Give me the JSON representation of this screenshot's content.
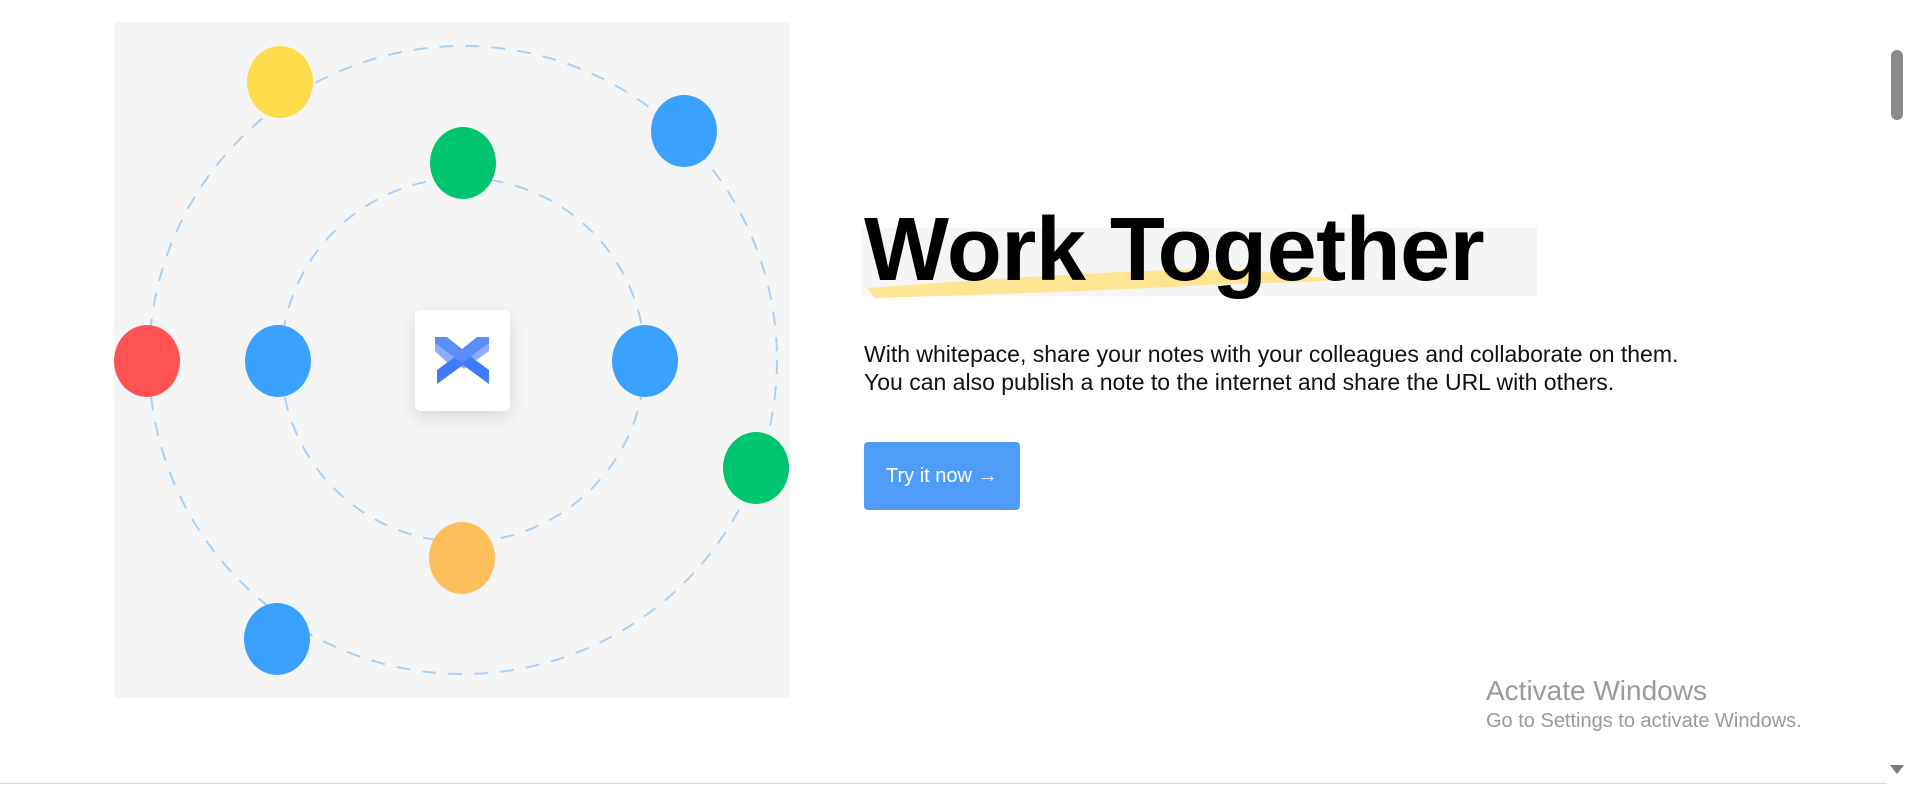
{
  "hero": {
    "title": "Work Together",
    "description_line1": "With whitepace, share your notes with your colleagues and collaborate on them.",
    "description_line2": "You can also publish a note to the internet and share the URL with others.",
    "cta_label": "Try it now →"
  },
  "illustration": {
    "center_icon": "whitepace-logo-icon",
    "dot_colors": {
      "yellow": "#FFDC4B",
      "blue": "#3BA1FF",
      "green": "#00C46E",
      "red": "#FF5252",
      "orange": "#FFBE5C"
    }
  },
  "colors": {
    "accent": "#4F9CF9",
    "highlight_stroke": "#FFE492",
    "panel_bg": "#F5F5F5",
    "orbit_dash": "#A8D0F5"
  },
  "system_watermark": {
    "title": "Activate Windows",
    "subtitle": "Go to Settings to activate Windows."
  }
}
